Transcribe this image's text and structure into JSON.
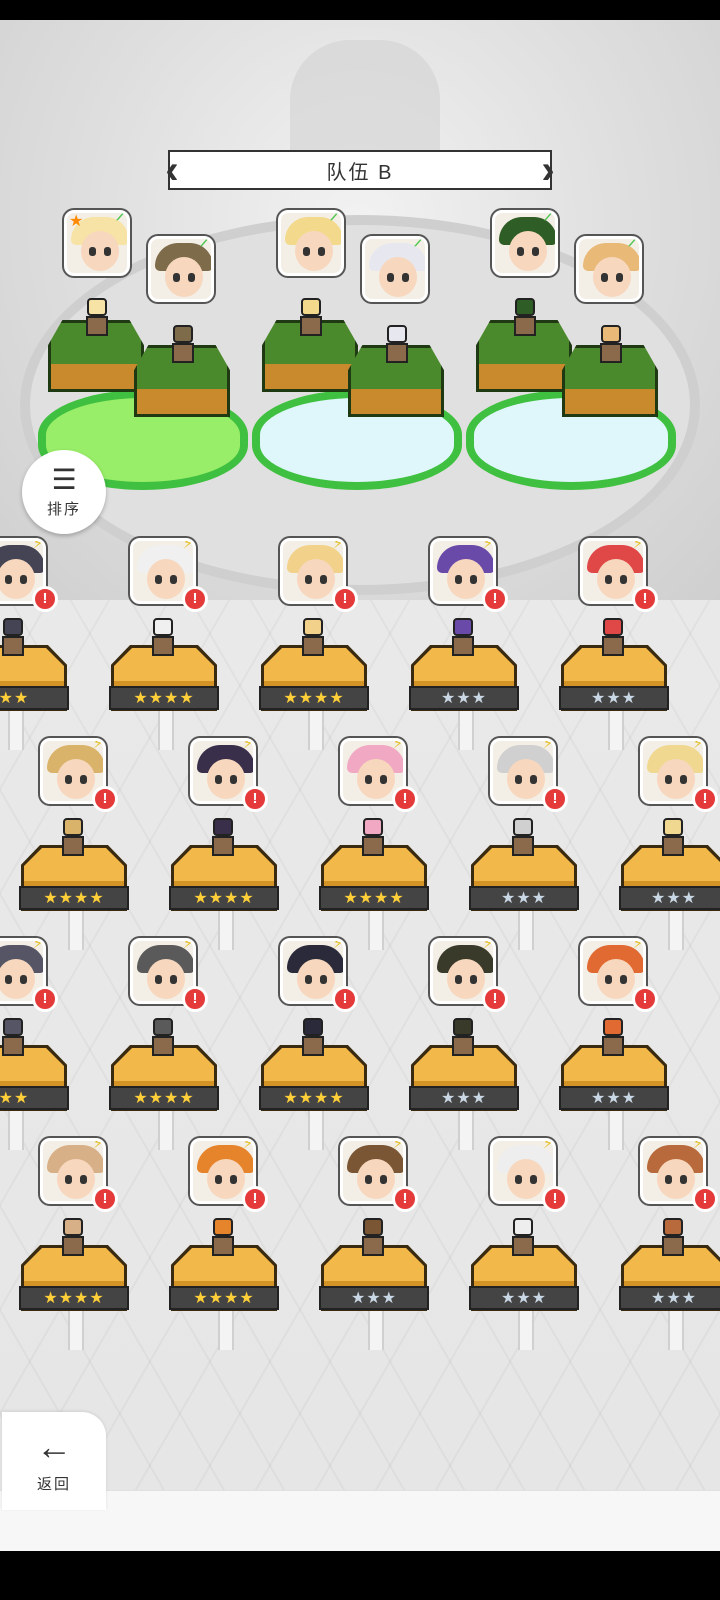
{
  "team": {
    "title": "队伍 B",
    "prev_icon": "chevron-left-icon",
    "next_icon": "chevron-right-icon"
  },
  "slots": [
    {
      "platform": "green",
      "members": [
        {
          "element": "earth",
          "marked": true,
          "hair": "#f7e3a6"
        },
        {
          "element": "earth",
          "marked": false,
          "hair": "#7d6b4a"
        }
      ]
    },
    {
      "platform": "blue",
      "members": [
        {
          "element": "earth",
          "marked": false,
          "hair": "#f3d98b"
        },
        {
          "element": "earth",
          "marked": false,
          "hair": "#e7e7ef"
        }
      ]
    },
    {
      "platform": "blue",
      "members": [
        {
          "element": "earth",
          "marked": false,
          "hair": "#2f5d26"
        },
        {
          "element": "earth",
          "marked": false,
          "hair": "#e9b978"
        }
      ]
    }
  ],
  "sort": {
    "label": "排序",
    "icon": "sort-icon"
  },
  "roster": {
    "rows": [
      [
        {
          "hair": "#445",
          "element": "bolt",
          "stars": "★★",
          "rank": "gold",
          "partial": "left"
        },
        {
          "hair": "#f0f0f0",
          "element": "bolt",
          "stars": "★★★★",
          "rank": "gold"
        },
        {
          "hair": "#f2d28a",
          "element": "bolt",
          "stars": "★★★★",
          "rank": "gold"
        },
        {
          "hair": "#6a4aa8",
          "element": "bolt",
          "stars": "★★★",
          "rank": "silver"
        },
        {
          "hair": "#e04848",
          "element": "bolt",
          "stars": "★★★",
          "rank": "silver"
        }
      ],
      [
        {
          "hair": "#d9b36a",
          "element": "bolt",
          "stars": "★★★★",
          "rank": "gold"
        },
        {
          "hair": "#3a2f4a",
          "element": "bolt",
          "stars": "★★★★",
          "rank": "gold"
        },
        {
          "hair": "#f1a8c3",
          "element": "bolt",
          "stars": "★★★★",
          "rank": "gold"
        },
        {
          "hair": "#d0d0d0",
          "element": "bolt",
          "stars": "★★★",
          "rank": "silver"
        },
        {
          "hair": "#f0d890",
          "element": "bolt",
          "stars": "★★★",
          "rank": "silver"
        }
      ],
      [
        {
          "hair": "#556",
          "element": "bolt",
          "stars": "★★",
          "rank": "gold",
          "partial": "left"
        },
        {
          "hair": "#5a5a5a",
          "element": "bolt",
          "stars": "★★★★",
          "rank": "gold"
        },
        {
          "hair": "#2a2a3a",
          "element": "bolt",
          "stars": "★★★★",
          "rank": "gold"
        },
        {
          "hair": "#3a3a2a",
          "element": "bolt",
          "stars": "★★★",
          "rank": "silver"
        },
        {
          "hair": "#e06a32",
          "element": "bolt",
          "stars": "★★★",
          "rank": "silver"
        }
      ],
      [
        {
          "hair": "#d8b088",
          "element": "bolt",
          "stars": "★★★★",
          "rank": "gold"
        },
        {
          "hair": "#e6842c",
          "element": "bolt",
          "stars": "★★★★",
          "rank": "gold"
        },
        {
          "hair": "#7a5634",
          "element": "bolt",
          "stars": "★★★",
          "rank": "silver"
        },
        {
          "hair": "#eeeeee",
          "element": "bolt",
          "stars": "★★★",
          "rank": "silver"
        },
        {
          "hair": "#b86a3c",
          "element": "bolt",
          "stars": "★★★",
          "rank": "silver"
        }
      ]
    ]
  },
  "back": {
    "label": "返回",
    "icon": "arrow-left-icon"
  },
  "colors": {
    "alert": "#e43a3a",
    "gold_star": "#ffcf3a",
    "silver_star": "#c9d6e4"
  }
}
